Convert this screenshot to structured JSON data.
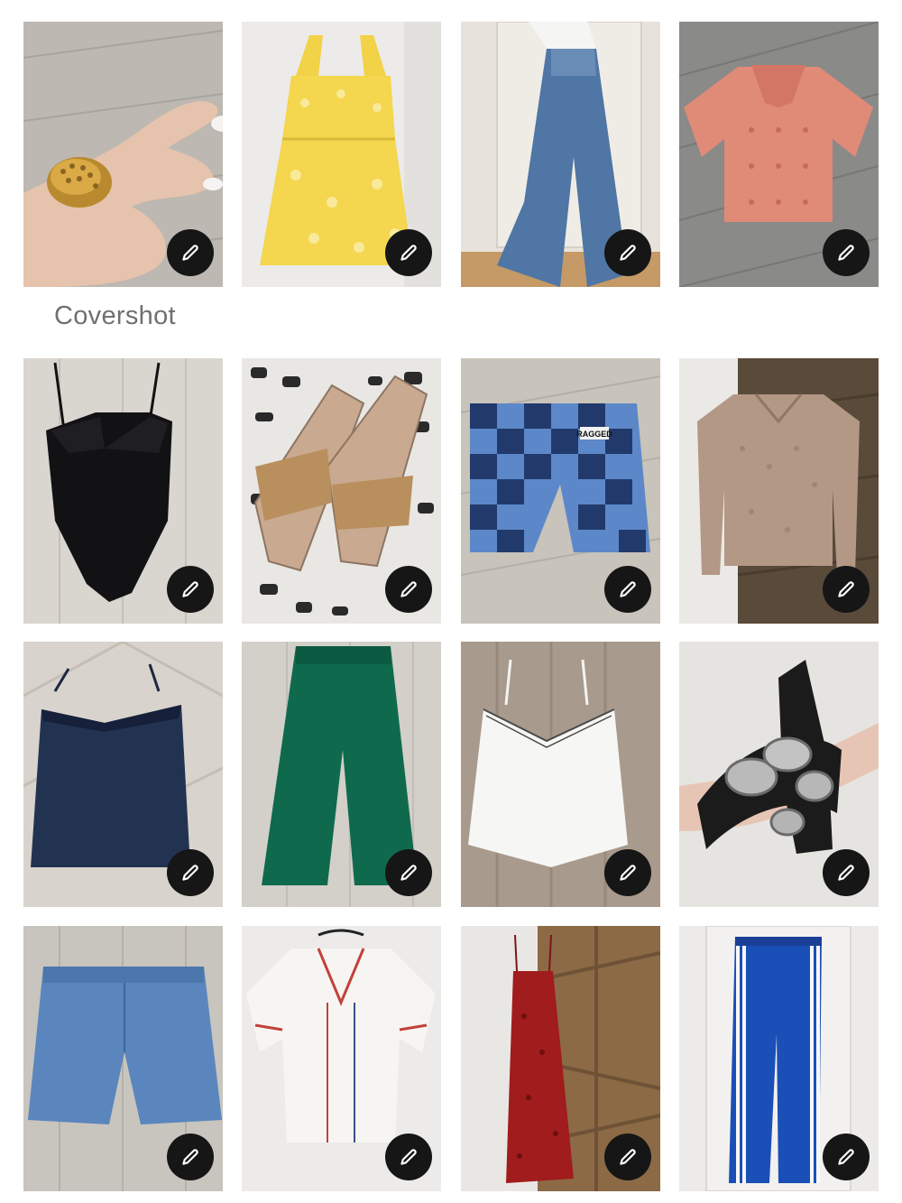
{
  "section": {
    "covershot_label": "Covershot"
  },
  "edit_icon": "pencil-icon",
  "items": [
    {
      "name": "gold-hedgehog-ring",
      "icon": "pencil-icon"
    },
    {
      "name": "yellow-floral-dress",
      "icon": "pencil-icon"
    },
    {
      "name": "wide-leg-jeans",
      "icon": "pencil-icon"
    },
    {
      "name": "pink-knit-polo",
      "icon": "pencil-icon"
    },
    {
      "name": "black-bodysuit",
      "icon": "pencil-icon"
    },
    {
      "name": "raffia-slide-sandals",
      "icon": "pencil-icon"
    },
    {
      "name": "patchwork-denim-pants",
      "icon": "pencil-icon",
      "tag_text": "RAGGED"
    },
    {
      "name": "tan-knit-cardigan",
      "icon": "pencil-icon"
    },
    {
      "name": "navy-lace-cami",
      "icon": "pencil-icon"
    },
    {
      "name": "green-wide-pants",
      "icon": "pencil-icon"
    },
    {
      "name": "white-cami-top",
      "icon": "pencil-icon"
    },
    {
      "name": "concho-belt",
      "icon": "pencil-icon"
    },
    {
      "name": "denim-shorts",
      "icon": "pencil-icon"
    },
    {
      "name": "white-embroidered-blouse",
      "icon": "pencil-icon"
    },
    {
      "name": "red-slip-dress",
      "icon": "pencil-icon"
    },
    {
      "name": "blue-track-pants",
      "icon": "pencil-icon"
    }
  ],
  "colors": {
    "edit_button_bg": "#161616",
    "label_text": "#707070",
    "background": "#ffffff"
  }
}
